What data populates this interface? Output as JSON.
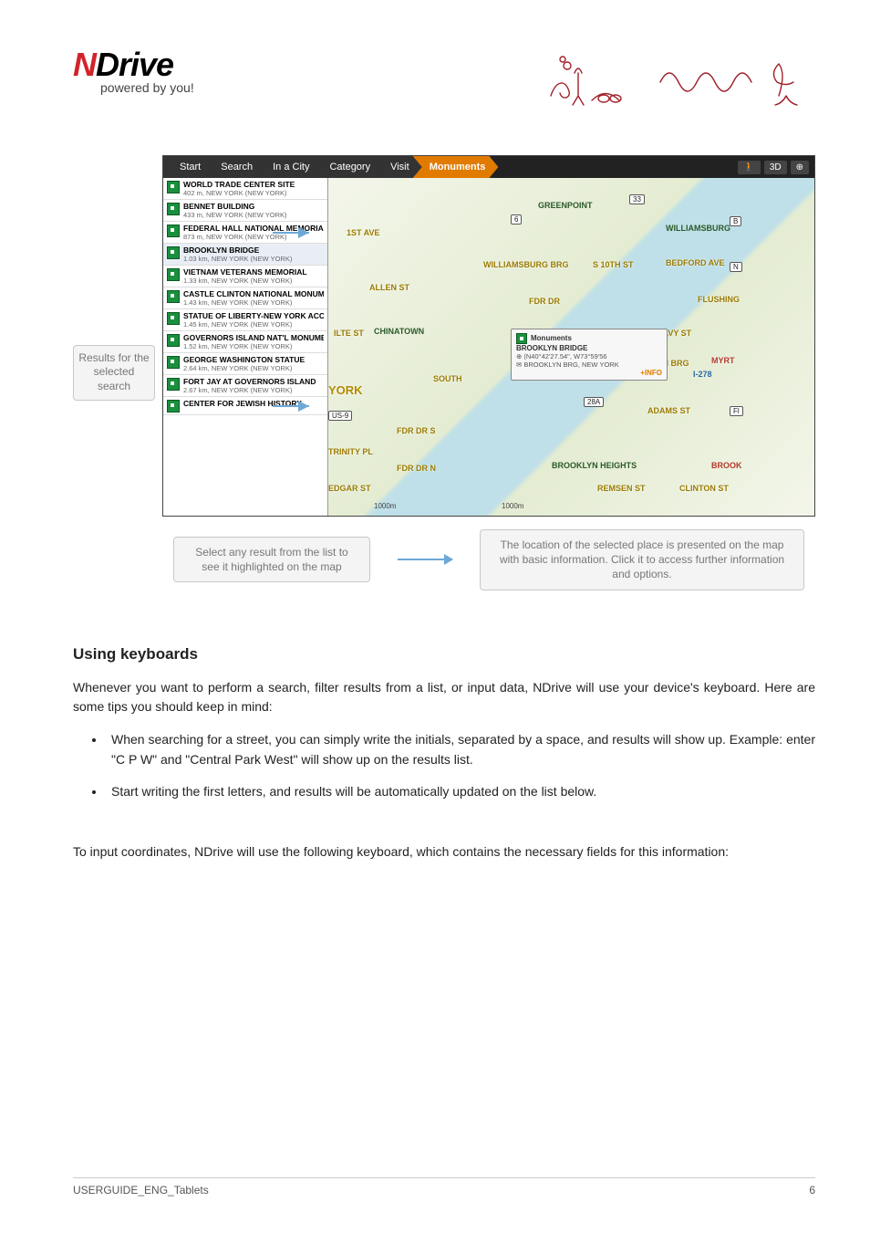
{
  "logo": {
    "brand_n": "N",
    "brand_rest": "Drive",
    "tagline": "powered by you!"
  },
  "breadcrumb": {
    "items": [
      "Start",
      "Search",
      "In a City",
      "Category",
      "Visit",
      "Monuments"
    ],
    "active_index": 5,
    "tool_3d": "3D"
  },
  "side_label": "Results for the selected search",
  "results": [
    {
      "title": "WORLD TRADE CENTER SITE",
      "sub": "402 m, NEW YORK (NEW YORK)"
    },
    {
      "title": "BENNET BUILDING",
      "sub": "433 m, NEW YORK (NEW YORK)"
    },
    {
      "title": "FEDERAL HALL NATIONAL MEMORIAL",
      "sub": "873 m, NEW YORK (NEW YORK)"
    },
    {
      "title": "BROOKLYN BRIDGE",
      "sub": "1.03 km, NEW YORK (NEW YORK)"
    },
    {
      "title": "VIETNAM VETERANS MEMORIAL",
      "sub": "1.33 km, NEW YORK (NEW YORK)"
    },
    {
      "title": "CASTLE CLINTON NATIONAL MONUM",
      "sub": "1.43 km, NEW YORK (NEW YORK)"
    },
    {
      "title": "STATUE OF LIBERTY-NEW YORK ACC",
      "sub": "1.45 km, NEW YORK (NEW YORK)"
    },
    {
      "title": "GOVERNORS ISLAND NAT'L MONUMEN",
      "sub": "1.52 km, NEW YORK (NEW YORK)"
    },
    {
      "title": "GEORGE WASHINGTON STATUE",
      "sub": "2.64 km, NEW YORK (NEW YORK)"
    },
    {
      "title": "FORT JAY AT GOVERNORS ISLAND",
      "sub": "2.67 km, NEW YORK (NEW YORK)"
    },
    {
      "title": "CENTER FOR JEWISH HISTORY",
      "sub": ""
    }
  ],
  "map_labels": {
    "greenpoint": "GREENPOINT",
    "first_ave": "1ST AVE",
    "williamsburg": "WILLIAMSBURG",
    "wburg_brg": "WILLIAMSBURG BRG",
    "s10th": "S 10TH ST",
    "bedford": "BEDFORD AVE",
    "allen": "ALLEN ST",
    "fdr_dr": "FDR DR",
    "flushing": "FLUSHING",
    "chinatown": "CHINATOWN",
    "navy": "NAVY ST",
    "an_brg": "AN BRG",
    "myrt": "MYRT",
    "i278": "I-278",
    "south": "SOUTH",
    "york": "YORK",
    "fdr_s": "FDR DR S",
    "fdr_n": "FDR DR N",
    "trinity": "TRINITY PL",
    "edgar": "EDGAR ST",
    "brook_hts": "BROOKLYN HEIGHTS",
    "brook": "BROOK",
    "remsen": "REMSEN ST",
    "clinton": "CLINTON ST",
    "adams": "ADAMS ST",
    "us9": "US-9",
    "r33": "33",
    "r6": "6",
    "r28a": "28A",
    "rB": "B",
    "rN": "N",
    "rFl": "Fl",
    "lite_st": "ILTE ST",
    "scale1": "1000m",
    "scale2": "1000m"
  },
  "place_card": {
    "category": "Monuments",
    "name": "BROOKLYN BRIDGE",
    "coords": "(N40°42'27.54\", W73°59'56",
    "addr": "BROOKLYN BRG, NEW YORK",
    "info": "+INFO"
  },
  "callouts": {
    "left": "Select any result from the list to see it highlighted on the map",
    "right": "The location of the selected place is presented on the map with basic information. Click it to access further information and options."
  },
  "section_title": "Using keyboards",
  "para_intro": "Whenever you want to perform a search, filter results from a list, or input data, NDrive will use your device's keyboard. Here are some tips you should keep in mind:",
  "tips": [
    "When searching for a street, you can simply write the initials, separated by a space, and results will show up. Example: enter \"C P W\" and \"Central Park West\" will show up on the results list.",
    "Start writing the first letters, and results will be automatically updated on the list below."
  ],
  "para_coord": "To input coordinates, NDrive will use the following keyboard, which contains the necessary fields for this information:",
  "footer": {
    "left": "USERGUIDE_ENG_Tablets",
    "right": "6"
  }
}
